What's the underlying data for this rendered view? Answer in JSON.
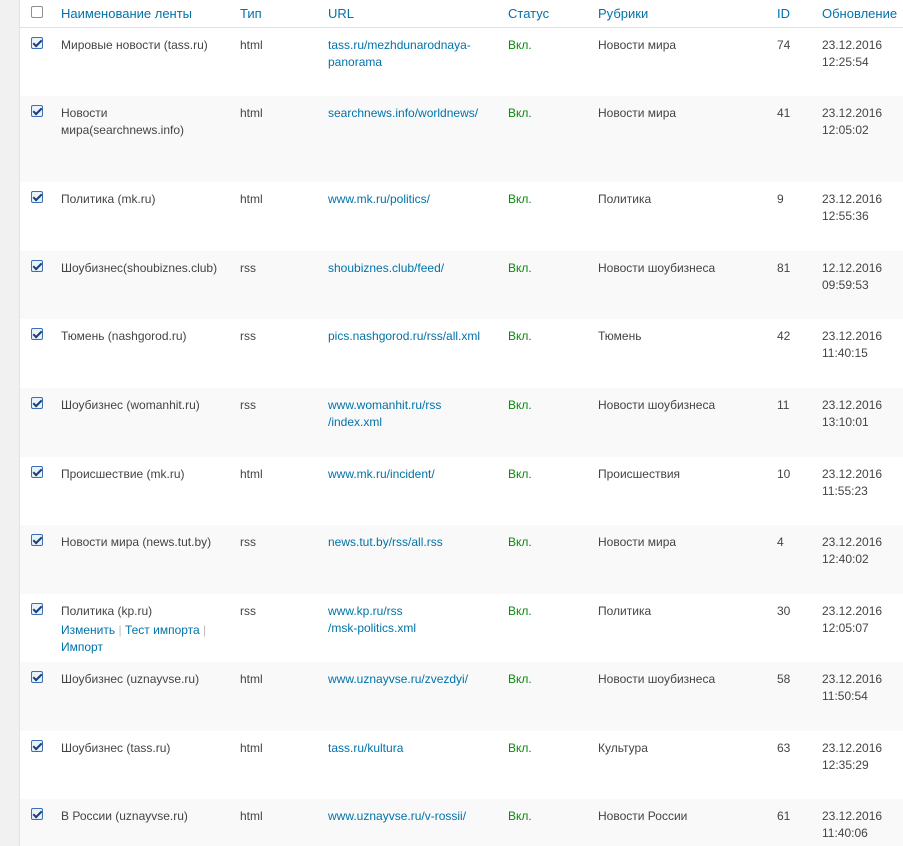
{
  "table": {
    "headers": {
      "name": "Наименование ленты",
      "type": "Тип",
      "url": "URL",
      "status": "Статус",
      "rubrics": "Рубрики",
      "id": "ID",
      "updated": "Обновление"
    },
    "rows": [
      {
        "name": "Мировые новости (tass.ru)",
        "type": "html",
        "url1": "tass.ru/mezhdunarodnaya-",
        "url2": "panorama",
        "status": "Вкл.",
        "rubric": "Новости мира",
        "id": "74",
        "date": "23.12.2016",
        "time": "12:25:54",
        "checked": true
      },
      {
        "name1": "Новости",
        "name2": "мира(searchnews.info)",
        "type": "html",
        "url1": "searchnews.info/worldnews/",
        "url2": "",
        "status": "Вкл.",
        "rubric": "Новости мира",
        "id": "41",
        "date": "23.12.2016",
        "time": "12:05:02",
        "checked": true
      },
      {
        "name": "Политика (mk.ru)",
        "type": "html",
        "url1": "www.mk.ru/politics/",
        "url2": "",
        "status": "Вкл.",
        "rubric": "Политика",
        "id": "9",
        "date": "23.12.2016",
        "time": "12:55:36",
        "checked": true
      },
      {
        "name": "Шоубизнес(shoubiznes.club)",
        "type": "rss",
        "url1": "shoubiznes.club/feed/",
        "url2": "",
        "status": "Вкл.",
        "rubric": "Новости шоубизнеса",
        "id": "81",
        "date": "12.12.2016",
        "time": "09:59:53",
        "checked": true
      },
      {
        "name": "Тюмень (nashgorod.ru)",
        "type": "rss",
        "url1": "pics.nashgorod.ru/rss/all.xml",
        "url2": "",
        "status": "Вкл.",
        "rubric": "Тюмень",
        "id": "42",
        "date": "23.12.2016",
        "time": "11:40:15",
        "checked": true
      },
      {
        "name": "Шоубизнес (womanhit.ru)",
        "type": "rss",
        "url1": "www.womanhit.ru/rss",
        "url2": "/index.xml",
        "status": "Вкл.",
        "rubric": "Новости шоубизнеса",
        "id": "11",
        "date": "23.12.2016",
        "time": "13:10:01",
        "checked": true
      },
      {
        "name": "Происшествие (mk.ru)",
        "type": "html",
        "url1": "www.mk.ru/incident/",
        "url2": "",
        "status": "Вкл.",
        "rubric": "Происшествия",
        "id": "10",
        "date": "23.12.2016",
        "time": "11:55:23",
        "checked": true
      },
      {
        "name": "Новости мира (news.tut.by)",
        "type": "rss",
        "url1": "news.tut.by/rss/all.rss",
        "url2": "",
        "status": "Вкл.",
        "rubric": "Новости мира",
        "id": "4",
        "date": "23.12.2016",
        "time": "12:40:02",
        "checked": true
      },
      {
        "name": "Политика (kp.ru)",
        "type": "rss",
        "url1": "www.kp.ru/rss",
        "url2": "/msk-politics.xml",
        "status": "Вкл.",
        "rubric": "Политика",
        "id": "30",
        "date": "23.12.2016",
        "time": "12:05:07",
        "checked": true,
        "actions": {
          "edit": "Изменить",
          "test": "Тест импорта",
          "import": "Импорт",
          "sep": "|"
        }
      },
      {
        "name": "Шоубизнес (uznayvse.ru)",
        "type": "html",
        "url1": "www.uznayvse.ru/zvezdyi/",
        "url2": "",
        "status": "Вкл.",
        "rubric": "Новости шоубизнеса",
        "id": "58",
        "date": "23.12.2016",
        "time": "11:50:54",
        "checked": true
      },
      {
        "name": "Шоубизнес (tass.ru)",
        "type": "html",
        "url1": "tass.ru/kultura",
        "url2": "",
        "status": "Вкл.",
        "rubric": "Культура",
        "id": "63",
        "date": "23.12.2016",
        "time": "12:35:29",
        "checked": true
      },
      {
        "name": "В России (uznayvse.ru)",
        "type": "html",
        "url1": "www.uznayvse.ru/v-rossii/",
        "url2": "",
        "status": "Вкл.",
        "rubric": "Новости России",
        "id": "61",
        "date": "23.12.2016",
        "time": "11:40:06",
        "checked": true
      }
    ]
  }
}
